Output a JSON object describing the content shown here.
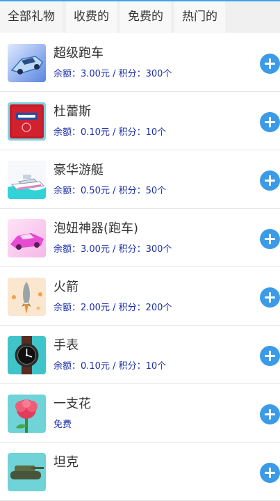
{
  "tabs": [
    {
      "label": "全部礼物"
    },
    {
      "label": "收费的"
    },
    {
      "label": "免费的"
    },
    {
      "label": "热门的"
    }
  ],
  "gifts": [
    {
      "name": "超级跑车",
      "price": "余额：3.00元 / 积分：300个",
      "icon": "supercar-icon"
    },
    {
      "name": "杜蕾斯",
      "price": "余额：0.10元 / 积分：10个",
      "icon": "durex-icon"
    },
    {
      "name": "豪华游艇",
      "price": "余额：0.50元 / 积分：50个",
      "icon": "yacht-icon"
    },
    {
      "name": "泡妞神器(跑车)",
      "price": "余额：3.00元 / 积分：300个",
      "icon": "pink-sportscar-icon"
    },
    {
      "name": "火箭",
      "price": "余额：2.00元 / 积分：200个",
      "icon": "rocket-icon"
    },
    {
      "name": "手表",
      "price": "余额：0.10元 / 积分：10个",
      "icon": "watch-icon"
    },
    {
      "name": "一支花",
      "price": "免费",
      "icon": "flower-icon"
    },
    {
      "name": "坦克",
      "price": "",
      "icon": "tank-icon"
    }
  ],
  "colors": {
    "accent": "#3c9be6",
    "price_text": "#1a2ea8"
  }
}
